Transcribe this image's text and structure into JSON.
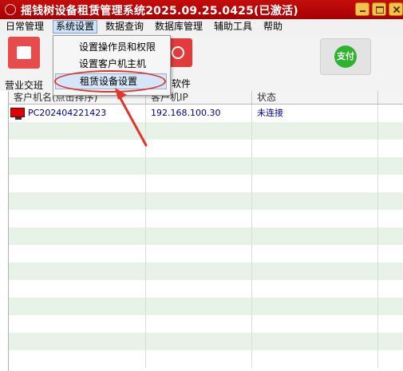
{
  "window": {
    "title": "摇钱树设备租赁管理系统2025.09.25.0425(已激活)"
  },
  "menubar": {
    "items": [
      "日常管理",
      "系统设置",
      "数据查询",
      "数据库管理",
      "辅助工具",
      "帮助"
    ]
  },
  "toolbar": {
    "shift_label": "营业交班",
    "software_label": "软件",
    "pay_label": "支付"
  },
  "dropdown": {
    "items": [
      "设置操作员和权限",
      "设置客户机主机",
      "租赁设备设置"
    ],
    "highlighted_index": 2
  },
  "grid": {
    "columns": [
      "客户机名(点击排序)",
      "客户机IP",
      "状态"
    ],
    "rows": [
      {
        "name": "PC202404221423",
        "ip": "192.168.100.30",
        "status": "未连接"
      }
    ]
  },
  "colors": {
    "title_bar": "#b80505",
    "row_alt": "#e7f3e7",
    "highlight": "#d5e6f8",
    "annotation": "#e2332c",
    "status_text": "#00008b"
  }
}
